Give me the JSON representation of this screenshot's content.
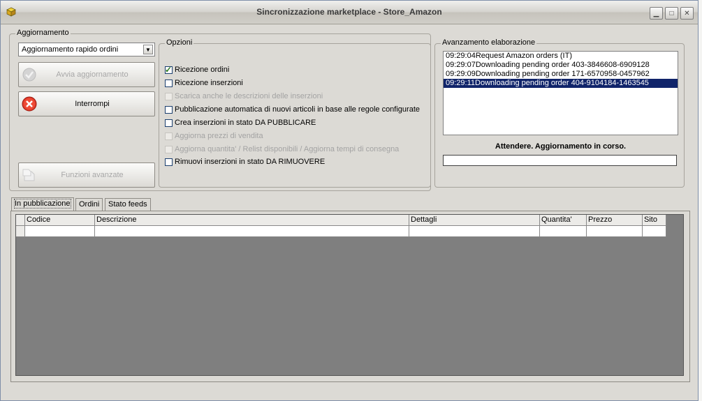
{
  "window": {
    "title": "Sincronizzazione marketplace - Store_Amazon"
  },
  "titlebar_buttons": {
    "minimize": "▁",
    "maximize": "□",
    "close": "✕"
  },
  "aggiornamento": {
    "label": "Aggiornamento",
    "combo_value": "Aggiornamento rapido ordini",
    "avvia_label": "Avvia aggiornamento",
    "interrompi_label": "Interrompi",
    "funzioni_label": "Funzioni avanzate"
  },
  "opzioni": {
    "label": "Opzioni",
    "items": [
      {
        "label": "Ricezione ordini",
        "checked": true,
        "enabled": true
      },
      {
        "label": "Ricezione inserzioni",
        "checked": false,
        "enabled": true
      },
      {
        "label": "Scarica anche le descrizioni delle inserzioni",
        "checked": false,
        "enabled": false
      },
      {
        "label": "Pubblicazione automatica di nuovi articoli in base alle regole configurate",
        "checked": false,
        "enabled": true
      },
      {
        "label": "Crea inserzioni in stato DA PUBBLICARE",
        "checked": false,
        "enabled": true
      },
      {
        "label": "Aggiorna prezzi di vendita",
        "checked": false,
        "enabled": false
      },
      {
        "label": "Aggiorna quantita' / Relist disponibili / Aggiorna tempi di consegna",
        "checked": false,
        "enabled": false
      },
      {
        "label": "Rimuovi inserzioni in stato DA RIMUOVERE",
        "checked": false,
        "enabled": true
      }
    ]
  },
  "avanzamento": {
    "label": "Avanzamento elaborazione",
    "log": [
      "09:29:04Request Amazon orders (IT)",
      "09:29:07Downloading pending order 403-3846608-6909128",
      "09:29:09Downloading pending order 171-6570958-0457962",
      "09:29:11Downloading pending order 404-9104184-1463545"
    ],
    "selected_index": 3,
    "status": "Attendere. Aggiornamento in corso."
  },
  "tabs": [
    "In pubblicazione",
    "Ordini",
    "Stato feeds"
  ],
  "grid": {
    "columns": [
      "Codice",
      "Descrizione",
      "Dettagli",
      "Quantita'",
      "Prezzo",
      "Sito"
    ]
  },
  "colors": {
    "selection": "#10246a",
    "grid_background": "#7f7f7f",
    "window": "#dcdad5"
  }
}
